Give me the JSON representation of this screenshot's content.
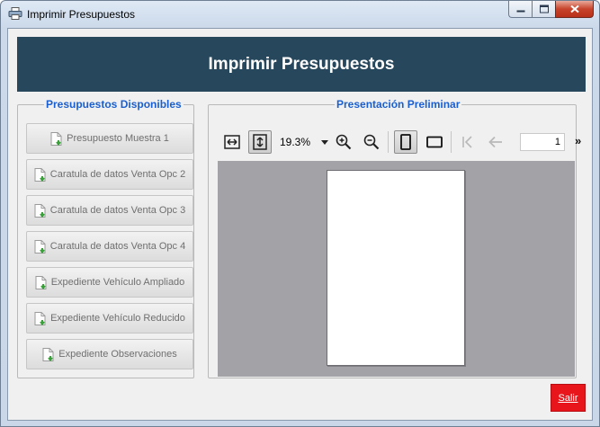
{
  "window": {
    "title": "Imprimir Presupuestos",
    "app_icon": "printer-icon",
    "controls": [
      "minimize-icon",
      "maximize-icon",
      "close-icon"
    ]
  },
  "banner": {
    "title": "Imprimir Presupuestos",
    "background": "#26475c"
  },
  "available_panel": {
    "legend": "Presupuestos Disponibles",
    "buttons": [
      {
        "label": "Presupuesto Muestra 1",
        "icon": "document-download-icon"
      },
      {
        "label": "Caratula de datos Venta Opc 2",
        "icon": "document-download-icon"
      },
      {
        "label": "Caratula de datos Venta Opc 3",
        "icon": "document-download-icon"
      },
      {
        "label": "Caratula de datos Venta Opc 4",
        "icon": "document-download-icon"
      },
      {
        "label": "Expediente Vehículo Ampliado",
        "icon": "document-download-icon"
      },
      {
        "label": "Expediente Vehículo Reducido",
        "icon": "document-download-icon"
      },
      {
        "label": "Expediente Observaciones",
        "icon": "document-download-icon"
      }
    ]
  },
  "preview_panel": {
    "legend": "Presentación Preliminar",
    "toolbar": {
      "fit_width_icon": "fit-width-icon",
      "fit_height_icon": "fit-height-icon",
      "zoom_value": "19.3%",
      "zoom_in_icon": "zoom-in-icon",
      "zoom_out_icon": "zoom-out-icon",
      "portrait_icon": "portrait-icon",
      "landscape_icon": "landscape-icon",
      "first_page_icon": "first-page-icon",
      "prev_page_icon": "previous-page-icon",
      "page_number": "1",
      "more_label": "»"
    }
  },
  "footer": {
    "exit_label": "Salir",
    "exit_color": "#e8151b"
  },
  "colors": {
    "legend": "#1a5fd0",
    "preview_background": "#a3a2a7"
  }
}
